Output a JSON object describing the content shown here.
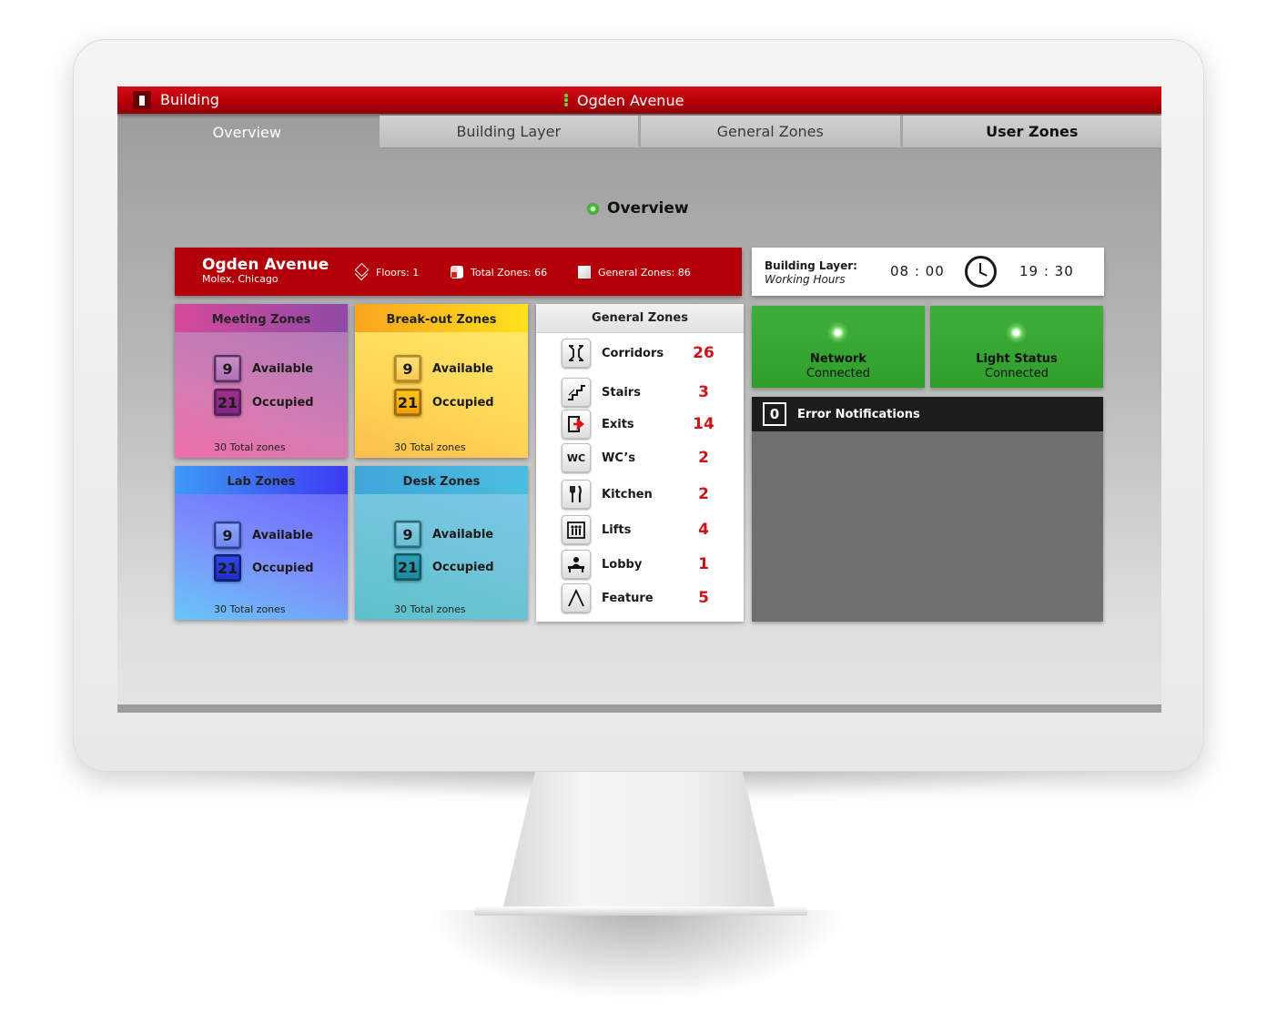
{
  "app": {
    "title": "Building",
    "site_title": "Ogden Avenue"
  },
  "tabs": [
    {
      "label": "Overview",
      "active": true
    },
    {
      "label": "Building Layer",
      "active": false
    },
    {
      "label": "General Zones",
      "active": false
    },
    {
      "label": "User Zones",
      "active": false
    }
  ],
  "page": {
    "section_title": "Overview"
  },
  "site": {
    "name": "Ogden Avenue",
    "location": "Molex, Chicago",
    "floors": "Floors: 1",
    "total_zones": "Total Zones: 66",
    "general_zones": "General Zones: 86"
  },
  "building_layer": {
    "label": "Building Layer:",
    "sub": "Working Hours",
    "start": "08 : 00",
    "end": "19 : 30"
  },
  "zones": {
    "meeting": {
      "title": "Meeting Zones",
      "available": "9",
      "occupied": "21",
      "available_label": "Available",
      "occupied_label": "Occupied",
      "total": "30 Total zones"
    },
    "breakout": {
      "title": "Break-out Zones",
      "available": "9",
      "occupied": "21",
      "available_label": "Available",
      "occupied_label": "Occupied",
      "total": "30 Total zones"
    },
    "lab": {
      "title": "Lab Zones",
      "available": "9",
      "occupied": "21",
      "available_label": "Available",
      "occupied_label": "Occupied",
      "total": "30 Total zones"
    },
    "desk": {
      "title": "Desk Zones",
      "available": "9",
      "occupied": "21",
      "available_label": "Available",
      "occupied_label": "Occupied",
      "total": "30 Total zones"
    }
  },
  "general_zones": {
    "title": "General Zones",
    "items": [
      {
        "name": "Corridors",
        "count": "26",
        "icon": "corridor-icon"
      },
      {
        "name": "Stairs",
        "count": "3",
        "icon": "stairs-icon"
      },
      {
        "name": "Exits",
        "count": "14",
        "icon": "exit-icon"
      },
      {
        "name": "WC’s",
        "count": "2",
        "icon": "wc-icon",
        "glyph": "WC"
      },
      {
        "name": "Kitchen",
        "count": "2",
        "icon": "kitchen-icon"
      },
      {
        "name": "Lifts",
        "count": "4",
        "icon": "lift-icon"
      },
      {
        "name": "Lobby",
        "count": "1",
        "icon": "lobby-icon"
      },
      {
        "name": "Feature",
        "count": "5",
        "icon": "feature-icon"
      }
    ]
  },
  "status": {
    "network": {
      "title": "Network",
      "state": "Connected"
    },
    "light": {
      "title": "Light Status",
      "state": "Connected"
    }
  },
  "errors": {
    "count": "0",
    "title": "Error Notifications"
  },
  "colors": {
    "brand_red": "#b30009",
    "status_green": "#35a631",
    "count_red": "#d0101a"
  }
}
